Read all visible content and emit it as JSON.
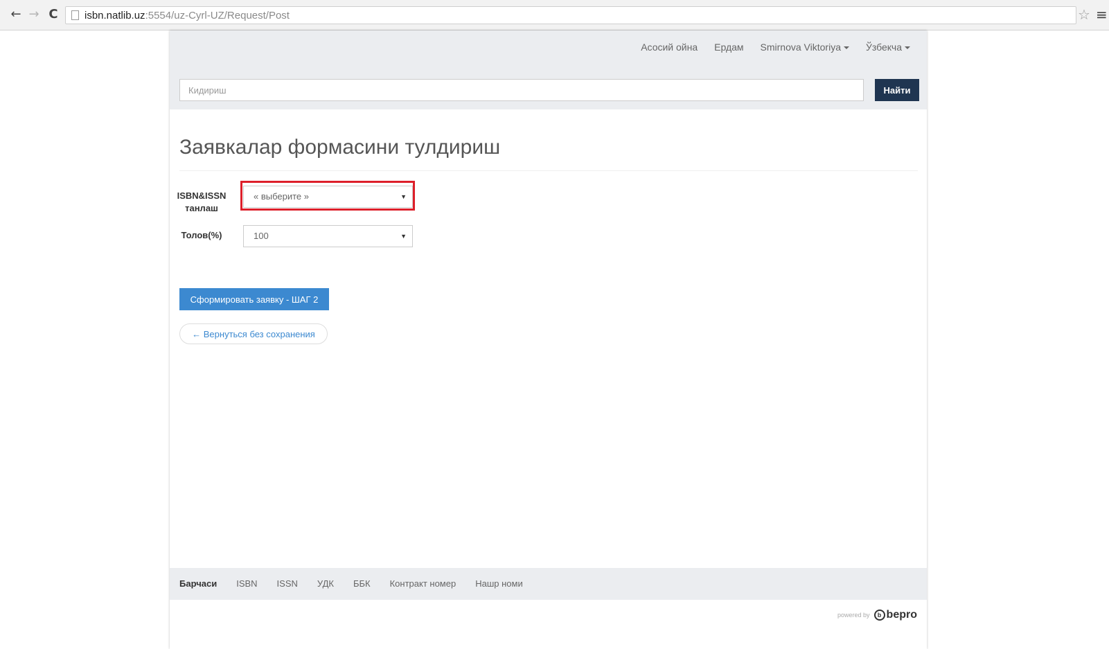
{
  "browser": {
    "url_host": "isbn.natlib.uz",
    "url_path": ":5554/uz-Cyrl-UZ/Request/Post"
  },
  "topnav": {
    "home": "Асосий ойна",
    "help": "Ердам",
    "user": "Smirnova Viktoriya",
    "language": "Ўзбекча"
  },
  "search": {
    "placeholder": "Кидириш",
    "button": "Найти"
  },
  "page": {
    "title": "Заявкалар формасини тулдириш"
  },
  "form": {
    "isbn_label": "ISBN&ISSN танлаш",
    "isbn_value": "« выберите »",
    "tolov_label": "Толов(%)",
    "tolov_value": "100",
    "submit": "Сформировать заявку - ШАГ 2",
    "back": "← Вернуться без сохранения"
  },
  "footer": {
    "links": [
      "Барчаси",
      "ISBN",
      "ISSN",
      "УДК",
      "ББК",
      "Контракт номер",
      "Нашр номи"
    ],
    "powered_by": "powered by",
    "brand": "bepro"
  },
  "colors": {
    "header_bg": "#ebedf0",
    "search_button": "#1f3551",
    "primary_button": "#3c89d0",
    "highlight": "#dd1f2a"
  }
}
